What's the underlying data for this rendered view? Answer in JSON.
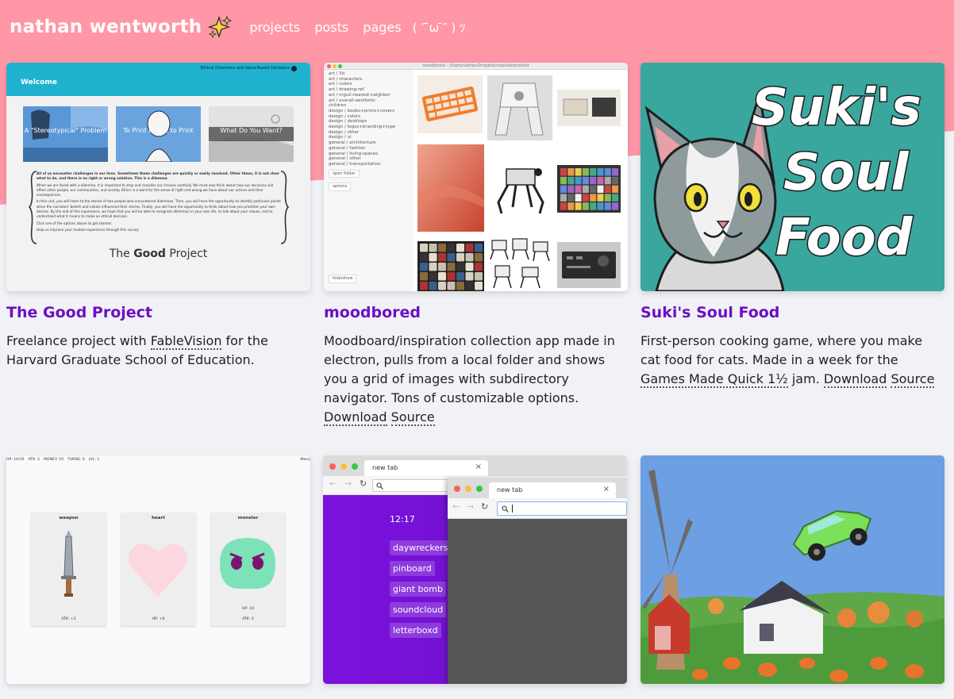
{
  "header": {
    "brand": "nathan wentworth",
    "nav": [
      "projects",
      "posts",
      "pages"
    ],
    "kaomoji": "( ″ ̄ω ̄″ ) ﾂ"
  },
  "colors": {
    "pink": "#ff97a6",
    "accent_purple": "#6d0fc4",
    "bg": "#f1f2f6"
  },
  "projects": [
    {
      "title": "The Good Project",
      "desc_before": "Freelance project with ",
      "desc_link": "FableVision",
      "desc_after": " for the Harvard Graduate School of Education.",
      "thumb": {
        "heading": "Welcome",
        "corner_text": "Ethical Dilemmas and Value-Based Decisions",
        "tiles": [
          "A \"Stereotypical\" Problem",
          "To Print or Not to Print",
          "What Do You Want?"
        ],
        "paragraphs": [
          "All of us encounter challenges in our lives. Sometimes these challenges are quickly or easily resolved. Other times, it is not clear what to do, and there is no right or wrong solution. This is a dilemma.",
          "When we are faced with a dilemma, it is important to stop and consider our choices carefully. We must also think about how our decisions will affect other people, our communities, and society. Ethics is a word for the sense of right and wrong we have about our actions and their consequences.",
          "In this unit, you will listen to the stories of two people who encountered dilemmas. Then, you will have the opportunity to identify particular points when the narrators' beliefs and values influenced their stories. Finally, you will have the opportunity to think about how you prioritize your own desires. By the end of this experience, we hope that you will be able to recognize dilemmas in your own life, to talk about your values, and to understand what it means to make an ethical decision.",
          "Click one of the options above to get started.",
          "Help us improve your module experience through this survey."
        ],
        "logo_a": "The ",
        "logo_b": "Good",
        "logo_c": " Project"
      }
    },
    {
      "title": "moodbored",
      "desc_before": "Moodboard/inspiration collection app made in electron, pulls from a local folder and shows you a grid of images with subdirectory navigator. Tons of customizable options. ",
      "link1": "Download",
      "link2": "Source",
      "thumb": {
        "window_title": "moodbored - /Users/nathan/Dropbox/inspiration/other",
        "folders": [
          "art / 3d",
          "art / characters",
          "art / colors",
          "art / drawing-ref",
          "art / mgs2-nearest-neighbor",
          "art / overall-aesthetic",
          "children",
          "design / books+prints+covers",
          "design / colors",
          "design / desktops",
          "design / logos+branding+type",
          "design / other",
          "design / ui",
          "general / architecture",
          "general / fashion",
          "general / living-spaces",
          "general / other",
          "general / transportation"
        ],
        "open_folder": "open folder",
        "options": "options",
        "hide_show": "hide/show"
      }
    },
    {
      "title": "Suki's Soul Food",
      "desc_before": "First-person cooking game, where you make cat food for cats. Made in a week for the ",
      "desc_link": "Games Made Quick 1½",
      "desc_mid": " jam. ",
      "link1": "Download",
      "link2": "Source",
      "thumb": {
        "line1": "Suki's",
        "line2": "Soul",
        "line3": "Food"
      }
    },
    {
      "thumb": {
        "stats": [
          "HP: 10/10",
          "ATK: 2",
          "MONEY: 10",
          "TURNS: 0",
          "LVL: 1"
        ],
        "menu": "Menu",
        "cards": [
          {
            "label": "weapon",
            "foot": "ATK: +2"
          },
          {
            "label": "heart",
            "foot": "HP: +6"
          },
          {
            "label": "monster",
            "hp": "HP: 10",
            "foot": "ATK: 4"
          }
        ]
      }
    },
    {
      "thumb": {
        "tab_title": "new tab",
        "time": "12:17",
        "links": [
          "daywreckers",
          "pinboard",
          "giant bomb",
          "soundcloud",
          "letterboxd"
        ]
      }
    },
    {
      "thumb": {}
    }
  ]
}
